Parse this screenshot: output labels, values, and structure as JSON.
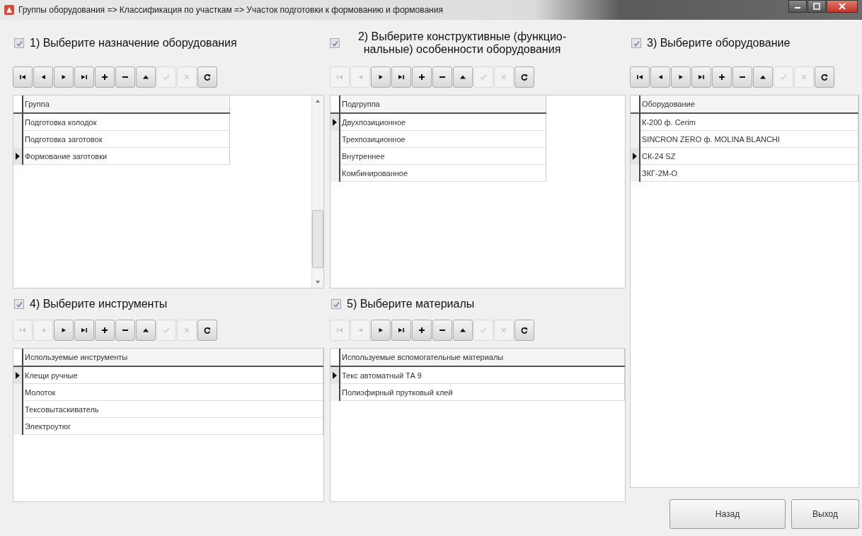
{
  "window": {
    "title": "Группы оборудования => Классификация по участкам => Участок подготовки к формованию и формования"
  },
  "panels": [
    {
      "checked": true,
      "title": "1) Выберите назначение  оборудования",
      "scrollbar": true,
      "toolbar": [
        {
          "kind": "first",
          "disabled": false
        },
        {
          "kind": "prior",
          "disabled": false
        },
        {
          "kind": "next",
          "disabled": false
        },
        {
          "kind": "last",
          "disabled": false
        },
        {
          "kind": "insert",
          "disabled": false
        },
        {
          "kind": "delete",
          "disabled": false
        },
        {
          "kind": "edit",
          "disabled": false
        },
        {
          "kind": "post",
          "disabled": true
        },
        {
          "kind": "cancel",
          "disabled": true
        },
        {
          "kind": "refresh",
          "disabled": false
        }
      ],
      "grid": {
        "column": "Группа",
        "rows": [
          {
            "text": "Подготовка колодок",
            "selected": false
          },
          {
            "text": "Подготовка заготовок",
            "selected": false
          },
          {
            "text": "Формование заготовки",
            "selected": true
          }
        ]
      }
    },
    {
      "checked": true,
      "title": "2) Выберите конструктивные (функцио-нальные) особенности оборудования",
      "toolbar": [
        {
          "kind": "first",
          "disabled": true
        },
        {
          "kind": "prior",
          "disabled": true
        },
        {
          "kind": "next",
          "disabled": false
        },
        {
          "kind": "last",
          "disabled": false
        },
        {
          "kind": "insert",
          "disabled": false
        },
        {
          "kind": "delete",
          "disabled": false
        },
        {
          "kind": "edit",
          "disabled": false
        },
        {
          "kind": "post",
          "disabled": true
        },
        {
          "kind": "cancel",
          "disabled": true
        },
        {
          "kind": "refresh",
          "disabled": false
        }
      ],
      "grid": {
        "column": "Подгруппа",
        "rows": [
          {
            "text": "Двухпозиционное",
            "selected": true
          },
          {
            "text": "Трехпозиционное",
            "selected": false
          },
          {
            "text": "Внутреннее",
            "selected": false
          },
          {
            "text": "Комбинированное",
            "selected": false
          }
        ]
      }
    },
    {
      "checked": true,
      "title": "3) Выберите оборудование",
      "toolbar": [
        {
          "kind": "first",
          "disabled": false
        },
        {
          "kind": "prior",
          "disabled": false
        },
        {
          "kind": "next",
          "disabled": false
        },
        {
          "kind": "last",
          "disabled": false
        },
        {
          "kind": "insert",
          "disabled": false
        },
        {
          "kind": "delete",
          "disabled": false
        },
        {
          "kind": "edit",
          "disabled": false
        },
        {
          "kind": "post",
          "disabled": true
        },
        {
          "kind": "cancel",
          "disabled": true
        },
        {
          "kind": "refresh",
          "disabled": false
        }
      ],
      "grid": {
        "column": "Оборудование",
        "rows": [
          {
            "text": "К-200 ф. Cerim",
            "selected": false
          },
          {
            "text": "SINCRON ZERO ф. MOLINA BLANCHI",
            "selected": false
          },
          {
            "text": "СК-24 SZ",
            "selected": true
          },
          {
            "text": "ЗКГ-2М-О",
            "selected": false
          }
        ]
      }
    },
    {
      "checked": true,
      "title": "4) Выберите инструменты",
      "toolbar": [
        {
          "kind": "first",
          "disabled": true
        },
        {
          "kind": "prior",
          "disabled": true
        },
        {
          "kind": "next",
          "disabled": false
        },
        {
          "kind": "last",
          "disabled": false
        },
        {
          "kind": "insert",
          "disabled": false
        },
        {
          "kind": "delete",
          "disabled": false
        },
        {
          "kind": "edit",
          "disabled": false
        },
        {
          "kind": "post",
          "disabled": true
        },
        {
          "kind": "cancel",
          "disabled": true
        },
        {
          "kind": "refresh",
          "disabled": false
        }
      ],
      "grid": {
        "column": "Используемые инструменты",
        "rows": [
          {
            "text": "Клещи ручные",
            "selected": true
          },
          {
            "text": "Молоток",
            "selected": false
          },
          {
            "text": "Тексовытаскиватель",
            "selected": false
          },
          {
            "text": "Электроутюг",
            "selected": false
          }
        ]
      }
    },
    {
      "checked": true,
      "title": "5) Выберите материалы",
      "toolbar": [
        {
          "kind": "first",
          "disabled": true
        },
        {
          "kind": "prior",
          "disabled": true
        },
        {
          "kind": "next",
          "disabled": false
        },
        {
          "kind": "last",
          "disabled": false
        },
        {
          "kind": "insert",
          "disabled": false
        },
        {
          "kind": "delete",
          "disabled": false
        },
        {
          "kind": "edit",
          "disabled": false
        },
        {
          "kind": "post",
          "disabled": true
        },
        {
          "kind": "cancel",
          "disabled": true
        },
        {
          "kind": "refresh",
          "disabled": false
        }
      ],
      "grid": {
        "column": "Используемые вспомогательные материалы",
        "rows": [
          {
            "text": "Текс автоматный ТА 9",
            "selected": true
          },
          {
            "text": "Полиэфирный прутковый клей",
            "selected": false
          }
        ]
      }
    }
  ],
  "buttons": [
    {
      "label": "Назад"
    },
    {
      "label": "Выход"
    }
  ]
}
